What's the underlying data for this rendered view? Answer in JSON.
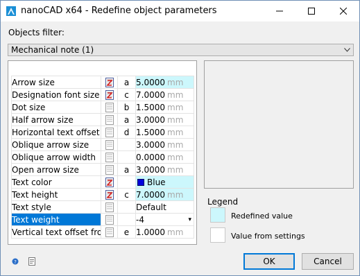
{
  "window": {
    "title": "nanoCAD x64 - Redefine object parameters"
  },
  "filter": {
    "label": "Objects filter:",
    "selected": "Mechanical note (1)"
  },
  "rows": [
    {
      "name": "Arrow size",
      "redefined": true,
      "code": "a",
      "value": "5.0000",
      "unit": "mm",
      "highlight": true
    },
    {
      "name": "Designation font size",
      "redefined": true,
      "code": "c",
      "value": "7.0000",
      "unit": "mm",
      "highlight": false
    },
    {
      "name": "Dot size",
      "redefined": false,
      "code": "b",
      "value": "1.5000",
      "unit": "mm",
      "highlight": false
    },
    {
      "name": "Half arrow size",
      "redefined": false,
      "code": "a",
      "value": "3.0000",
      "unit": "mm",
      "highlight": false
    },
    {
      "name": "Horizontal text offset fr",
      "redefined": false,
      "code": "d",
      "value": "1.5000",
      "unit": "mm",
      "highlight": false
    },
    {
      "name": "Oblique arrow size",
      "redefined": false,
      "code": "",
      "value": "3.0000",
      "unit": "mm",
      "highlight": false
    },
    {
      "name": "Oblique arrow width",
      "redefined": false,
      "code": "",
      "value": "0.0000",
      "unit": "mm",
      "highlight": false
    },
    {
      "name": "Open arrow size",
      "redefined": false,
      "code": "a",
      "value": "3.0000",
      "unit": "mm",
      "highlight": false
    },
    {
      "name": "Text color",
      "redefined": true,
      "code": "",
      "value": "Blue",
      "unit": "",
      "highlight": true,
      "color_swatch": "#0000dd"
    },
    {
      "name": "Text height",
      "redefined": true,
      "code": "c",
      "value": "7.0000",
      "unit": "mm",
      "highlight": true
    },
    {
      "name": "Text style",
      "redefined": false,
      "code": "",
      "value": "Default",
      "unit": "",
      "highlight": false
    },
    {
      "name": "Text weight",
      "redefined": false,
      "code": "",
      "value": "-4",
      "unit": "",
      "highlight": false,
      "selected": true,
      "dropdown": true
    },
    {
      "name": "Vertical text offset from",
      "redefined": false,
      "code": "e",
      "value": "1.0000",
      "unit": "mm",
      "highlight": false
    }
  ],
  "legend": {
    "title": "Legend",
    "redefined_label": "Redefined value",
    "settings_label": "Value from settings",
    "redefined_color": "#ccf7fc",
    "settings_color": "#ffffff"
  },
  "buttons": {
    "ok": "OK",
    "cancel": "Cancel"
  },
  "icons": {
    "help": "help-icon",
    "doc": "document-icon",
    "redefined": "redefined-param-icon",
    "default": "default-param-icon"
  },
  "colors": {
    "selection": "#0078d7",
    "highlight": "#ccf7fc"
  }
}
